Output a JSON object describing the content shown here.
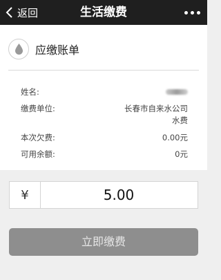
{
  "nav": {
    "back_label": "返回",
    "title": "生活缴费"
  },
  "bill": {
    "title": "应缴账单",
    "rows": [
      {
        "label": "姓名:",
        "value": ""
      },
      {
        "label": "缴费单位:",
        "value_line1": "长春市自来水公司",
        "value_line2": "水费"
      },
      {
        "label": "本次欠费:",
        "value": "0.00元"
      },
      {
        "label": "可用余额:",
        "value": "0元"
      }
    ]
  },
  "amount": {
    "currency_symbol": "¥",
    "value": "5.00"
  },
  "pay_button": {
    "label": "立即缴费"
  },
  "icons": {
    "back": "chevron-left-icon",
    "more": "more-dots-icon",
    "bill": "water-drop-icon"
  },
  "colors": {
    "nav_bg": "#1f1f1f",
    "button_bg": "#8e8e8e",
    "page_bg": "#efefef"
  }
}
